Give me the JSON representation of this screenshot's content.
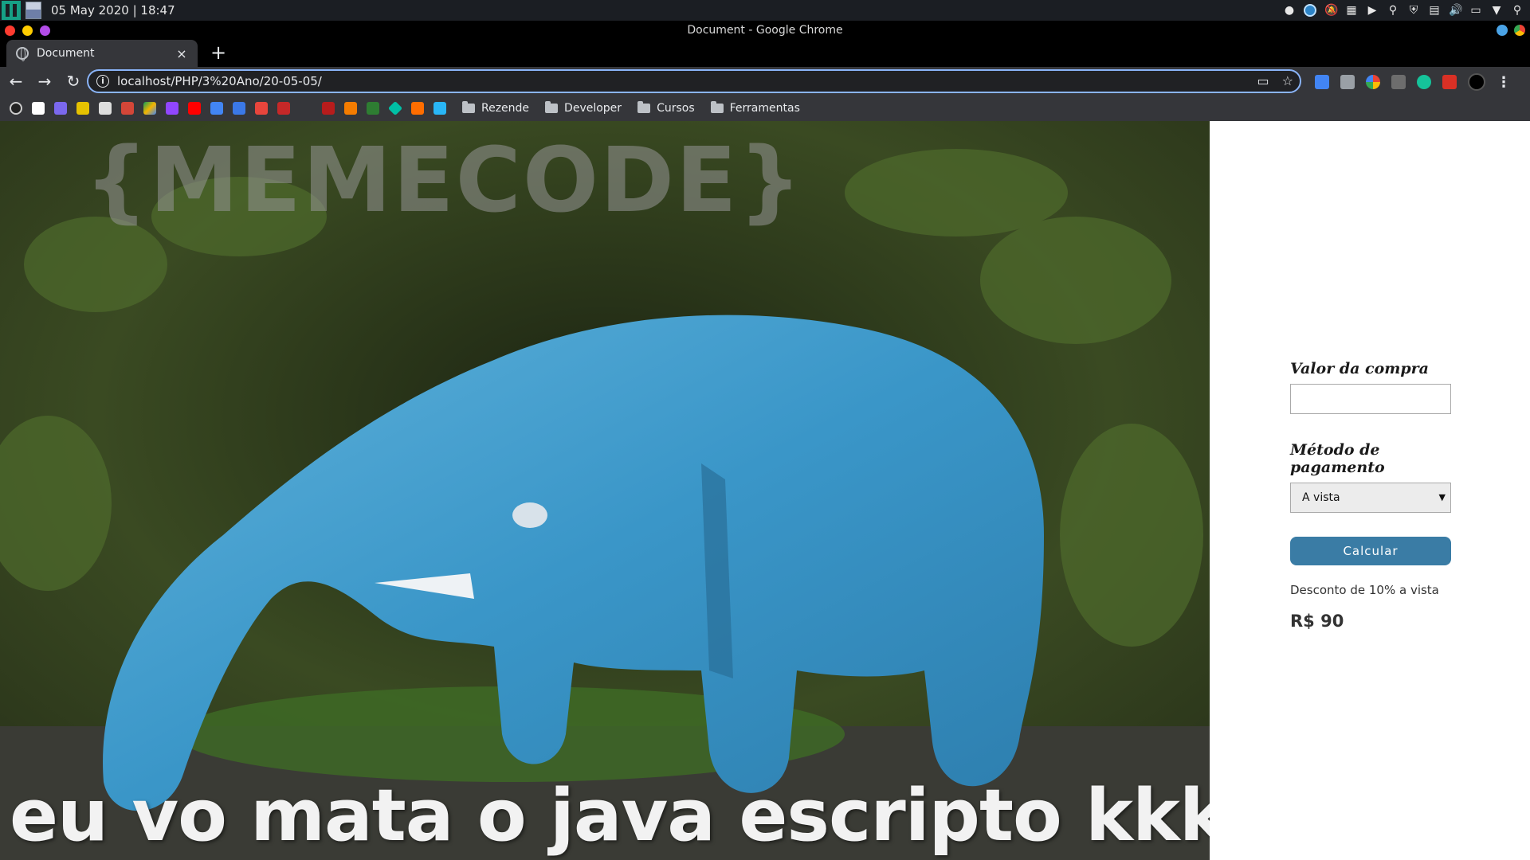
{
  "os": {
    "clock": "05 May 2020 | 18:47"
  },
  "window": {
    "title": "Document - Google Chrome"
  },
  "tab": {
    "title": "Document",
    "close": "×",
    "new_tab": "+"
  },
  "address": {
    "url": "localhost/PHP/3%20Ano/20-05-05/"
  },
  "bookmarks": {
    "folders": [
      "Rezende",
      "Developer",
      "Cursos",
      "Ferramentas"
    ]
  },
  "meme": {
    "watermark": "{MEMECODE}",
    "caption": "eu vo mata o java escripto kkkkkkk"
  },
  "form": {
    "valor_label": "Valor da compra",
    "valor_value": "",
    "metodo_label": "Método de pagamento",
    "metodo_selected": "A vista",
    "button_label": "Calcular",
    "discount_note": "Desconto de 10% a vista",
    "total": "R$ 90"
  },
  "colors": {
    "accent_button": "#3a7ca5",
    "omnibox_focus": "#8ab4f8",
    "os_panel": "#1b1e23"
  }
}
